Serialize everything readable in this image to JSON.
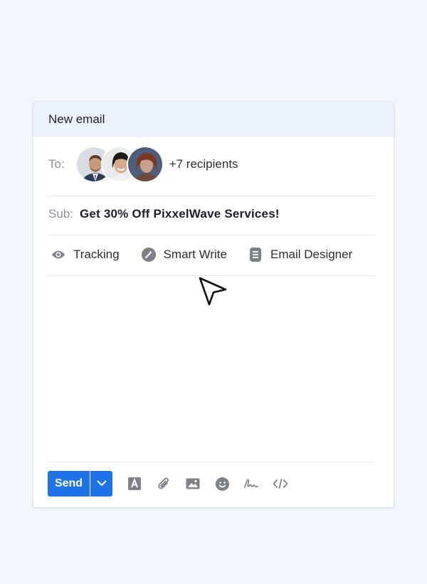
{
  "header": {
    "title": "New email"
  },
  "to": {
    "label": "To:",
    "avatars": [
      {
        "name": "avatar-man-suit"
      },
      {
        "name": "avatar-woman-smiling"
      },
      {
        "name": "avatar-woman-portrait"
      }
    ],
    "recipients_text": "+7 recipients"
  },
  "subject": {
    "label": "Sub:",
    "value": "Get 30% Off PixxelWave Services!"
  },
  "tools": [
    {
      "label": "Tracking",
      "icon": "eye-icon"
    },
    {
      "label": "Smart Write",
      "icon": "magic-wand-icon"
    },
    {
      "label": "Email Designer",
      "icon": "document-icon"
    }
  ],
  "footer": {
    "send_label": "Send",
    "icons": [
      "text-format-icon",
      "attachment-icon",
      "image-icon",
      "emoji-icon",
      "signature-icon",
      "code-icon"
    ]
  },
  "colors": {
    "background": "#f3f6fd",
    "header_bg": "#ecf2fc",
    "accent": "#1f73e9",
    "icon_gray": "#7d8088"
  }
}
